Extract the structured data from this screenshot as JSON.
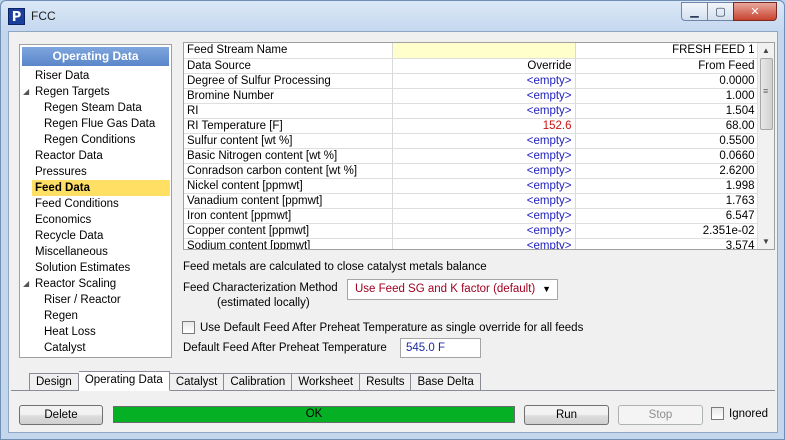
{
  "window": {
    "title": "FCC",
    "app_icon": "P"
  },
  "tree": {
    "header": "Operating Data",
    "items": [
      {
        "label": "Riser Data",
        "level": 0
      },
      {
        "label": "Regen Targets",
        "level": 0,
        "expander": true
      },
      {
        "label": "Regen Steam Data",
        "level": 1
      },
      {
        "label": "Regen Flue Gas Data",
        "level": 1
      },
      {
        "label": "Regen Conditions",
        "level": 1
      },
      {
        "label": "Reactor Data",
        "level": 0
      },
      {
        "label": "Pressures",
        "level": 0
      },
      {
        "label": "Feed Data",
        "level": 0,
        "selected": true
      },
      {
        "label": "Feed Conditions",
        "level": 0
      },
      {
        "label": "Economics",
        "level": 0
      },
      {
        "label": "Recycle Data",
        "level": 0
      },
      {
        "label": "Miscellaneous",
        "level": 0
      },
      {
        "label": "Solution Estimates",
        "level": 0
      },
      {
        "label": "Reactor Scaling",
        "level": 0,
        "expander": true
      },
      {
        "label": "Riser / Reactor",
        "level": 1
      },
      {
        "label": "Regen",
        "level": 1
      },
      {
        "label": "Heat Loss",
        "level": 1
      },
      {
        "label": "Catalyst",
        "level": 1
      }
    ]
  },
  "grid": {
    "rows": [
      {
        "name": "Feed Stream Name",
        "mid": "",
        "val": "FRESH FEED 1",
        "type": "head"
      },
      {
        "name": "Data Source",
        "mid": "Override",
        "val": "From Feed",
        "type": "plain"
      },
      {
        "name": "Degree of Sulfur Processing",
        "mid": "<empty>",
        "val": "0.0000",
        "type": "empty"
      },
      {
        "name": "Bromine Number",
        "mid": "<empty>",
        "val": "1.000",
        "type": "empty"
      },
      {
        "name": "RI",
        "mid": "<empty>",
        "val": "1.504",
        "type": "empty"
      },
      {
        "name": "RI Temperature [F]",
        "mid": "152.6",
        "val": "68.00",
        "type": "override"
      },
      {
        "name": "Sulfur content [wt %]",
        "mid": "<empty>",
        "val": "0.5500",
        "type": "empty"
      },
      {
        "name": "Basic Nitrogen content [wt %]",
        "mid": "<empty>",
        "val": "0.0660",
        "type": "empty"
      },
      {
        "name": "Conradson carbon content [wt %]",
        "mid": "<empty>",
        "val": "2.6200",
        "type": "empty"
      },
      {
        "name": "Nickel content [ppmwt]",
        "mid": "<empty>",
        "val": "1.998",
        "type": "empty"
      },
      {
        "name": "Vanadium content [ppmwt]",
        "mid": "<empty>",
        "val": "1.763",
        "type": "empty"
      },
      {
        "name": "Iron content [ppmwt]",
        "mid": "<empty>",
        "val": "6.547",
        "type": "empty"
      },
      {
        "name": "Copper content [ppmwt]",
        "mid": "<empty>",
        "val": "2.351e-02",
        "type": "empty"
      },
      {
        "name": "Sodium content [ppmwt]",
        "mid": "<empty>",
        "val": "3.574",
        "type": "empty"
      }
    ]
  },
  "feed_metals_note": "Feed metals are calculated to close catalyst metals balance",
  "feed_char": {
    "label": "Feed Characterization Method",
    "sublabel": "(estimated locally)",
    "value": "Use Feed SG and K factor (default)"
  },
  "use_default_checkbox": {
    "label": "Use Default Feed After Preheat Temperature as single override for all feeds",
    "checked": false
  },
  "default_temp": {
    "label": "Default Feed After Preheat Temperature",
    "value": "545.0 F"
  },
  "tabs": [
    {
      "label": "Design",
      "active": false
    },
    {
      "label": "Operating Data",
      "active": true
    },
    {
      "label": "Catalyst",
      "active": false
    },
    {
      "label": "Calibration",
      "active": false
    },
    {
      "label": "Worksheet",
      "active": false
    },
    {
      "label": "Results",
      "active": false
    },
    {
      "label": "Base Delta",
      "active": false
    }
  ],
  "footer": {
    "delete_label": "Delete",
    "status_text": "OK",
    "run_label": "Run",
    "stop_label": "Stop",
    "ignored_label": "Ignored",
    "ignored_checked": false
  }
}
